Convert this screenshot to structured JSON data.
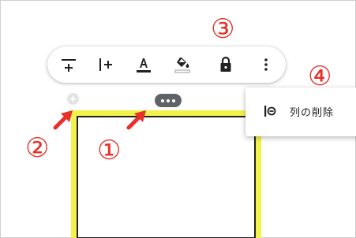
{
  "toolbar": {
    "buttons": [
      {
        "name": "insert-row",
        "icon": "insert-row-icon"
      },
      {
        "name": "insert-column",
        "icon": "insert-column-icon"
      },
      {
        "name": "text-color",
        "icon": "text-color-icon",
        "glyph": "A"
      },
      {
        "name": "fill-color",
        "icon": "fill-color-icon"
      },
      {
        "name": "lock",
        "icon": "lock-icon"
      },
      {
        "name": "more-options",
        "icon": "more-vert-icon"
      }
    ]
  },
  "context_menu": {
    "items": [
      {
        "label": "列の削除",
        "icon": "delete-column-icon"
      }
    ]
  },
  "annotations": {
    "one": "①",
    "two": "②",
    "three": "③",
    "four": "④"
  },
  "colors": {
    "highlight": "#f2f24a",
    "annotation": "#e8302a",
    "icon": "#202124",
    "handle": "#5f6368"
  }
}
